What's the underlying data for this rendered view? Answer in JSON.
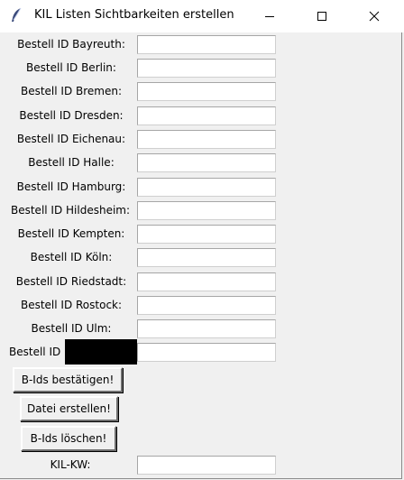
{
  "window": {
    "title": "KIL Listen Sichtbarkeiten erstellen"
  },
  "rows": [
    {
      "label": "Bestell ID Bayreuth:",
      "value": ""
    },
    {
      "label": "Bestell ID Berlin:",
      "value": ""
    },
    {
      "label": "Bestell ID Bremen:",
      "value": ""
    },
    {
      "label": "Bestell ID Dresden:",
      "value": ""
    },
    {
      "label": "Bestell ID Eichenau:",
      "value": ""
    },
    {
      "label": "Bestell ID Halle:",
      "value": ""
    },
    {
      "label": "Bestell ID Hamburg:",
      "value": ""
    },
    {
      "label": "Bestell ID Hildesheim:",
      "value": ""
    },
    {
      "label": "Bestell ID Kempten:",
      "value": ""
    },
    {
      "label": "Bestell ID Köln:",
      "value": ""
    },
    {
      "label": "Bestell ID Riedstadt:",
      "value": ""
    },
    {
      "label": "Bestell ID Rostock:",
      "value": ""
    },
    {
      "label": "Bestell ID Ulm:",
      "value": ""
    },
    {
      "label": "Bestell ID",
      "value": ""
    }
  ],
  "buttons": {
    "confirm": "B-Ids bestätigen!",
    "create_file": "Datei erstellen!",
    "delete": "B-Ids löschen!"
  },
  "kw": {
    "label": "KIL-KW:",
    "value": ""
  }
}
